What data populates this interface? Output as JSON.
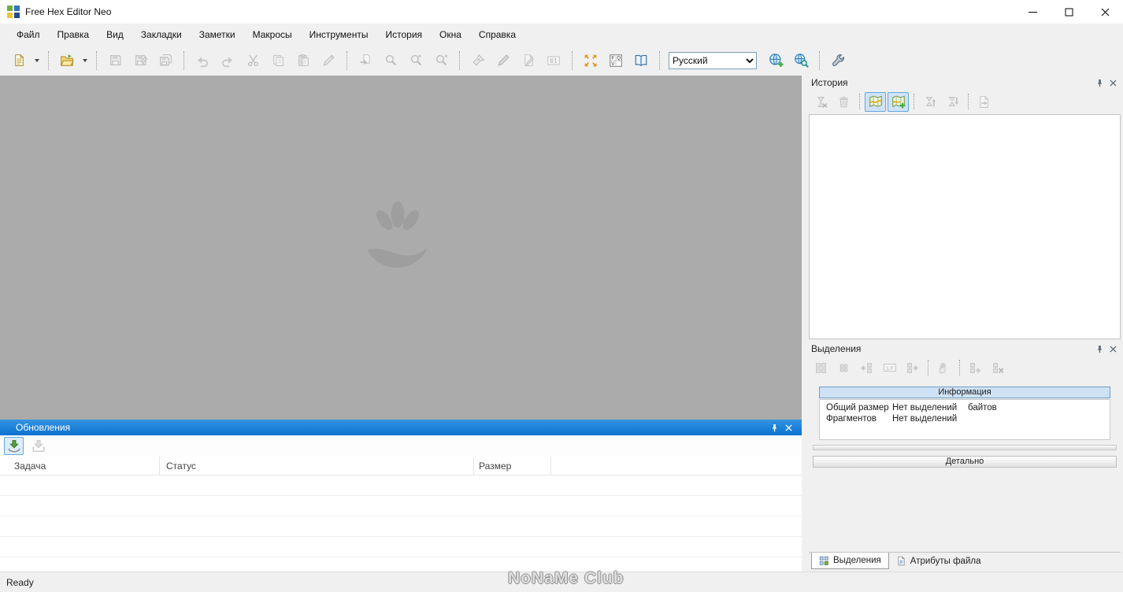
{
  "colors": {
    "titlebar_bg": "#ffffff",
    "chrome_bg": "#f0f0f0",
    "workspace_bg": "#ababab",
    "accent_blue": "#0b72cf",
    "selection_highlight": "#cfe3f7",
    "selection_border": "#66a7e0",
    "info_header_bg": "#cfe1f5"
  },
  "titlebar": {
    "title": "Free Hex Editor Neo"
  },
  "menubar": {
    "items": [
      "Файл",
      "Правка",
      "Вид",
      "Закладки",
      "Заметки",
      "Макросы",
      "Инструменты",
      "История",
      "Окна",
      "Справка"
    ]
  },
  "toolbar": {
    "language_selected": "Русский",
    "binary_icon_text": "01",
    "fqv_icon_letters": [
      "F",
      "Q",
      "V"
    ]
  },
  "history_panel": {
    "title": "История"
  },
  "selections_panel": {
    "title": "Выделения",
    "toolbar_onef_icon_text": "1.F",
    "info_header": "Информация",
    "info_rows": [
      {
        "label": "Общий размер",
        "value": "Нет выделений",
        "unit": "байтов"
      },
      {
        "label": "Фрагментов",
        "value": "Нет выделений",
        "unit": ""
      }
    ],
    "details_header": "Детально",
    "tabs": [
      {
        "label": "Выделения"
      },
      {
        "label": "Атрибуты файла"
      }
    ]
  },
  "updates_panel": {
    "title": "Обновления",
    "columns": [
      "Задача",
      "Статус",
      "Размер"
    ]
  },
  "statusbar": {
    "status": "Ready"
  },
  "watermark": {
    "text": "NoNaMe Club"
  }
}
